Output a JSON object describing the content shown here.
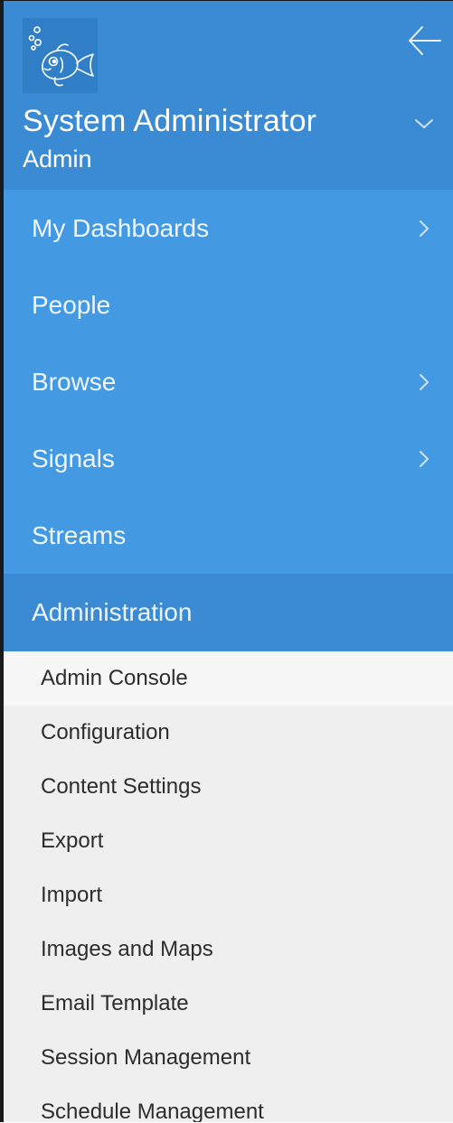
{
  "user": {
    "name": "System Administrator",
    "role": "Admin"
  },
  "icons": {
    "avatar": "fish-avatar-icon",
    "back": "arrow-left-icon",
    "expand": "chevron-down-icon",
    "submenu": "chevron-right-icon"
  },
  "colors": {
    "header_bg": "#3a8ad4",
    "nav_bg": "#4499e3",
    "active_bg": "#3a8ad4",
    "submenu_bg": "#efefef",
    "submenu_active_bg": "#f7f7f7"
  },
  "nav": {
    "items": [
      {
        "label": "My Dashboards",
        "has_submenu": true
      },
      {
        "label": "People",
        "has_submenu": false
      },
      {
        "label": "Browse",
        "has_submenu": true
      },
      {
        "label": "Signals",
        "has_submenu": true
      },
      {
        "label": "Streams",
        "has_submenu": false
      },
      {
        "label": "Administration",
        "has_submenu": false,
        "active": true
      }
    ]
  },
  "admin_menu": {
    "items": [
      {
        "label": "Admin Console",
        "active": true
      },
      {
        "label": "Configuration"
      },
      {
        "label": "Content Settings"
      },
      {
        "label": "Export"
      },
      {
        "label": "Import"
      },
      {
        "label": "Images and Maps"
      },
      {
        "label": "Email Template"
      },
      {
        "label": "Session Management"
      },
      {
        "label": "Schedule Management"
      }
    ]
  }
}
